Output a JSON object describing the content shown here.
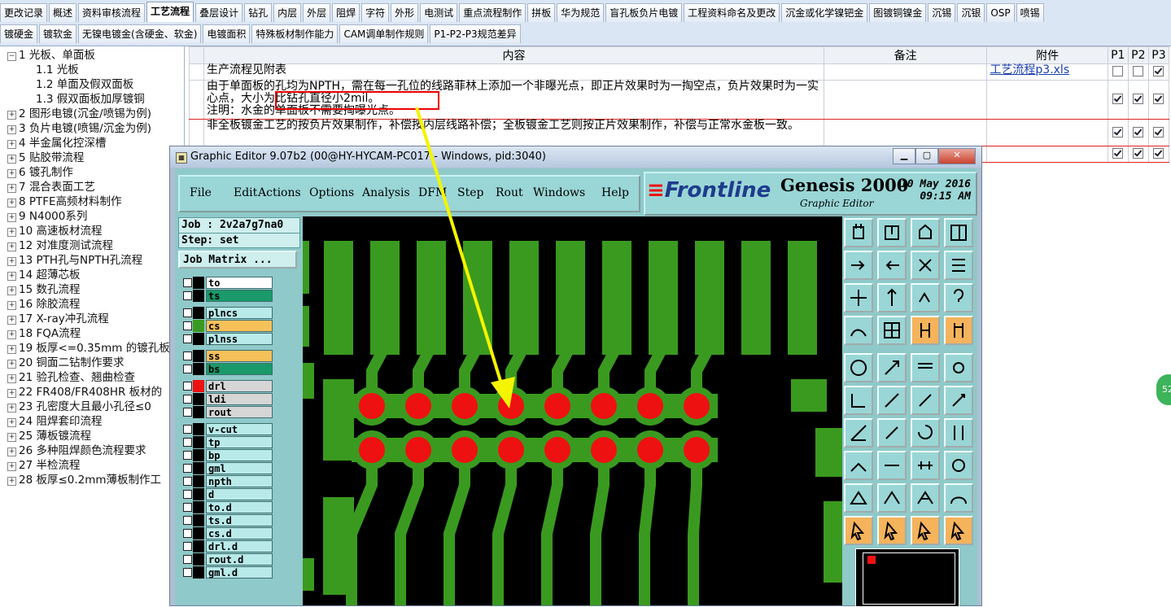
{
  "tabs_row1": [
    "更改记录",
    "概述",
    "资料审核流程",
    "工艺流程",
    "叠层设计",
    "钻孔",
    "内层",
    "外层",
    "阻焊",
    "字符",
    "外形",
    "电测试",
    "重点流程制作",
    "拼板",
    "华为规范",
    "盲孔板负片电镀",
    "工程资料命名及更改",
    "沉金或化学镍钯金",
    "图镀铜镍金",
    "沉锡",
    "沉银",
    "OSP",
    "喷锡"
  ],
  "tabs_row2": [
    "镀硬金",
    "镀软金",
    "无镍电镀金(含硬金、软金)",
    "电镀面积",
    "特殊板材制作能力",
    "CAM调单制作规则",
    "P1-P2-P3规范差异"
  ],
  "active_tab": "工艺流程",
  "tree": [
    {
      "label": "1 光板、单面板",
      "expanded": true
    },
    {
      "label": "1.1 光板",
      "child": true
    },
    {
      "label": "1.2 单面及假双面板",
      "child": true
    },
    {
      "label": "1.3 假双面板加厚镀铜",
      "child": true
    },
    {
      "label": "2 图形电镀(沉金/喷锡为例)"
    },
    {
      "label": "3 负片电镀(喷锡/沉金为例)"
    },
    {
      "label": "4 半金属化控深槽"
    },
    {
      "label": "5 贴胶带流程"
    },
    {
      "label": "6 镀孔制作"
    },
    {
      "label": "7 混合表面工艺"
    },
    {
      "label": "8 PTFE高频材料制作"
    },
    {
      "label": "9 N4000系列"
    },
    {
      "label": "10 高速板材流程"
    },
    {
      "label": "12 对准度测试流程"
    },
    {
      "label": "13 PTH孔与NPTH孔流程"
    },
    {
      "label": "14 超薄芯板"
    },
    {
      "label": "15 数孔流程"
    },
    {
      "label": "16 除胶流程"
    },
    {
      "label": "17 X-ray冲孔流程"
    },
    {
      "label": "18 FQA流程"
    },
    {
      "label": "19 板厚<=0.35mm 的镀孔板"
    },
    {
      "label": "20 铜面二钻制作要求"
    },
    {
      "label": "21 验孔检查、翘曲检查"
    },
    {
      "label": "22 FR408/FR408HR 板材的"
    },
    {
      "label": "23 孔密度大且最小孔径≤0"
    },
    {
      "label": "24 阻焊套印流程"
    },
    {
      "label": "25 薄板镀流程"
    },
    {
      "label": "26 多种阻焊颜色流程要求"
    },
    {
      "label": "27 半检流程"
    },
    {
      "label": "28 板厚≤0.2mm薄板制作工"
    }
  ],
  "grid": {
    "headers": {
      "content": "内容",
      "remark": "备注",
      "attach": "附件",
      "p1": "P1",
      "p2": "P2",
      "p3": "P3"
    },
    "rows": [
      {
        "content": "生产流程见附表",
        "remark": "",
        "attach": "工艺流程p3.xls",
        "p1": false,
        "p2": false,
        "p3": true
      },
      {
        "content": "由于单面板的孔均为NPTH，需在每一孔位的线路菲林上添加一个非曝光点，即正片效果时为一掏空点，负片效果时为一实心点，大小为比钻孔直径小2mil。\n注明：水金的单面板不需要掏曝光点。",
        "remark": "",
        "attach": "",
        "p1": true,
        "p2": true,
        "p3": true
      },
      {
        "content": "非全板镀金工艺的按负片效果制作，补偿按内层线路补偿；全板镀金工艺则按正片效果制作，补偿与正常水金板一致。",
        "remark": "",
        "attach": "",
        "p1": true,
        "p2": true,
        "p3": true
      },
      {
        "content": "",
        "remark": "",
        "attach": "",
        "p1": true,
        "p2": true,
        "p3": true
      }
    ]
  },
  "genesis": {
    "title": "Graphic Editor 9.07b2 (00@HY-HYCAM-PC017 - Windows, pid:3040)",
    "menu": [
      "File",
      "Edit",
      "Actions",
      "Options",
      "Analysis",
      "DFM",
      "Step",
      "Rout",
      "Windows",
      "Help"
    ],
    "brand": "Frontline",
    "product": "Genesis 2000",
    "subtitle": "Graphic Editor",
    "date": "10 May 2016",
    "time": "09:15 AM",
    "job": "Job : 2v2a7g7na0",
    "step": "Step: set",
    "job_matrix": "Job Matrix ...",
    "layers": [
      {
        "name": "to",
        "color": "#ffffff"
      },
      {
        "name": "ts",
        "color": "#1a9a6a"
      },
      {
        "name": "plncs",
        "color": "#b9eaea"
      },
      {
        "name": "cs",
        "color": "#f7c15a"
      },
      {
        "name": "plnss",
        "color": "#b9eaea"
      },
      {
        "name": "ss",
        "color": "#f7c15a"
      },
      {
        "name": "bs",
        "color": "#1a9a6a"
      },
      {
        "name": "drl",
        "color": "#d6d6d6"
      },
      {
        "name": "ldi",
        "color": "#d6d6d6"
      },
      {
        "name": "rout",
        "color": "#d6d6d6"
      },
      {
        "name": "v-cut",
        "color": "#b9eaea"
      },
      {
        "name": "tp",
        "color": "#b9eaea"
      },
      {
        "name": "bp",
        "color": "#b9eaea"
      },
      {
        "name": "gml",
        "color": "#b9eaea"
      },
      {
        "name": "npth",
        "color": "#b9eaea"
      },
      {
        "name": "d",
        "color": "#b9eaea"
      },
      {
        "name": "to.d",
        "color": "#b9eaea"
      },
      {
        "name": "ts.d",
        "color": "#b9eaea"
      },
      {
        "name": "cs.d",
        "color": "#b9eaea"
      },
      {
        "name": "drl.d",
        "color": "#b9eaea"
      },
      {
        "name": "rout.d",
        "color": "#b9eaea"
      },
      {
        "name": "gml.d",
        "color": "#b9eaea"
      }
    ]
  },
  "bubble": "52",
  "colors": {
    "copper": "#3a9a1f",
    "hole": "#ee1111",
    "canvas": "#000000",
    "accent_red": "#dd1111",
    "arrow": "#f4f400"
  }
}
